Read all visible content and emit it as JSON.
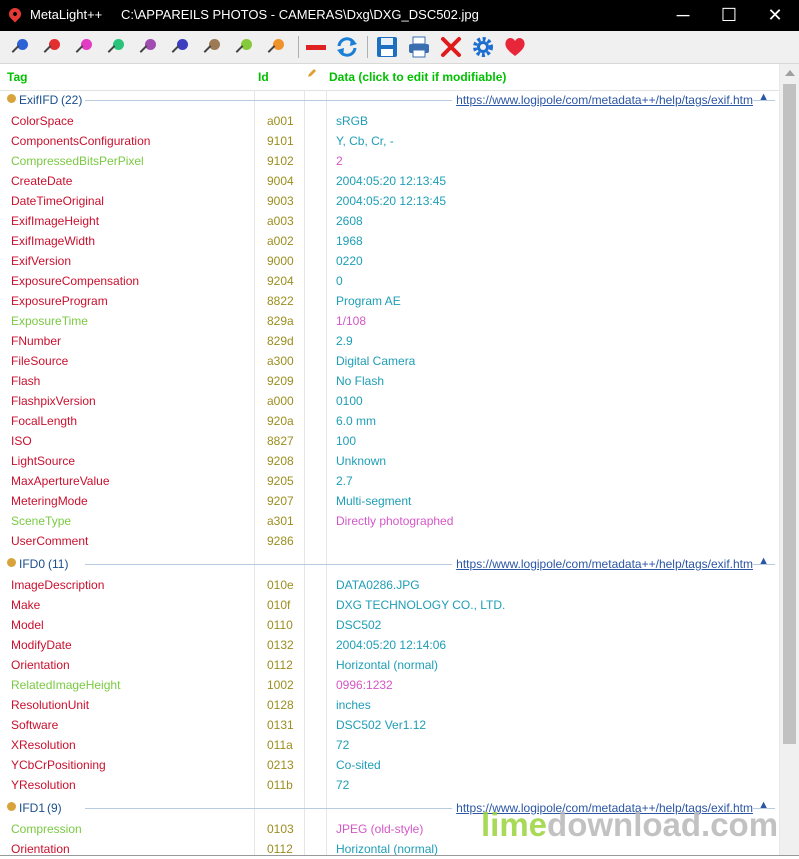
{
  "window": {
    "app_name": "MetaLight++",
    "file_path": "C:\\APPAREILS PHOTOS - CAMERAS\\Dxg\\DXG_DSC502.jpg",
    "minimize_glyph": "─",
    "maximize_glyph": "☐",
    "close_glyph": "✕"
  },
  "toolbar": {
    "pin_colors": [
      "#2c62d6",
      "#e32f2f",
      "#e23bc4",
      "#28c47a",
      "#a04cb0",
      "#3b3ec0",
      "#9b7a55",
      "#86c93a",
      "#f0922a"
    ],
    "icons": [
      "pin-icon",
      "remove-icon",
      "refresh-icon",
      "save-icon",
      "print-icon",
      "delete-icon",
      "settings-icon",
      "favorite-icon"
    ]
  },
  "columns": {
    "tag": "Tag",
    "id": "Id",
    "data": "Data (click to edit if modifiable)"
  },
  "colors": {
    "header": "#00c000",
    "tag_default": "#c8102e",
    "tag_readonly": "#7ac943",
    "id": "#9b8e1f",
    "value_default": "#1e9eb6",
    "value_readonly": "#d457c7",
    "group_name": "#1a4f8a",
    "link": "#2b56a4"
  },
  "groups": [
    {
      "name": "ExifIFD",
      "count": "(22)",
      "link": "https://www.logipole/com/metadata++/help/tags/exif.htm",
      "rows": [
        {
          "tag": "ColorSpace",
          "id": "a001",
          "value": "sRGB",
          "ro": false
        },
        {
          "tag": "ComponentsConfiguration",
          "id": "9101",
          "value": "Y, Cb, Cr, -",
          "ro": false
        },
        {
          "tag": "CompressedBitsPerPixel",
          "id": "9102",
          "value": "2",
          "ro": true
        },
        {
          "tag": "CreateDate",
          "id": "9004",
          "value": "2004:05:20 12:13:45",
          "ro": false
        },
        {
          "tag": "DateTimeOriginal",
          "id": "9003",
          "value": "2004:05:20 12:13:45",
          "ro": false
        },
        {
          "tag": "ExifImageHeight",
          "id": "a003",
          "value": "2608",
          "ro": false
        },
        {
          "tag": "ExifImageWidth",
          "id": "a002",
          "value": "1968",
          "ro": false
        },
        {
          "tag": "ExifVersion",
          "id": "9000",
          "value": "0220",
          "ro": false
        },
        {
          "tag": "ExposureCompensation",
          "id": "9204",
          "value": "0",
          "ro": false
        },
        {
          "tag": "ExposureProgram",
          "id": "8822",
          "value": "Program AE",
          "ro": false
        },
        {
          "tag": "ExposureTime",
          "id": "829a",
          "value": "1/108",
          "ro": true
        },
        {
          "tag": "FNumber",
          "id": "829d",
          "value": "2.9",
          "ro": false
        },
        {
          "tag": "FileSource",
          "id": "a300",
          "value": "Digital Camera",
          "ro": false
        },
        {
          "tag": "Flash",
          "id": "9209",
          "value": "No Flash",
          "ro": false
        },
        {
          "tag": "FlashpixVersion",
          "id": "a000",
          "value": "0100",
          "ro": false
        },
        {
          "tag": "FocalLength",
          "id": "920a",
          "value": "6.0 mm",
          "ro": false
        },
        {
          "tag": "ISO",
          "id": "8827",
          "value": "100",
          "ro": false
        },
        {
          "tag": "LightSource",
          "id": "9208",
          "value": "Unknown",
          "ro": false
        },
        {
          "tag": "MaxApertureValue",
          "id": "9205",
          "value": "2.7",
          "ro": false
        },
        {
          "tag": "MeteringMode",
          "id": "9207",
          "value": "Multi-segment",
          "ro": false
        },
        {
          "tag": "SceneType",
          "id": "a301",
          "value": "Directly photographed",
          "ro": true
        },
        {
          "tag": "UserComment",
          "id": "9286",
          "value": "",
          "ro": false
        }
      ]
    },
    {
      "name": "IFD0",
      "count": "(11)",
      "link": "https://www.logipole/com/metadata++/help/tags/exif.htm",
      "rows": [
        {
          "tag": "ImageDescription",
          "id": "010e",
          "value": "DATA0286.JPG",
          "ro": false
        },
        {
          "tag": "Make",
          "id": "010f",
          "value": "DXG TECHNOLOGY CO., LTD.",
          "ro": false
        },
        {
          "tag": "Model",
          "id": "0110",
          "value": "DSC502",
          "ro": false
        },
        {
          "tag": "ModifyDate",
          "id": "0132",
          "value": "2004:05:20 12:14:06",
          "ro": false
        },
        {
          "tag": "Orientation",
          "id": "0112",
          "value": "Horizontal (normal)",
          "ro": false
        },
        {
          "tag": "RelatedImageHeight",
          "id": "1002",
          "value": "0996:1232",
          "ro": true
        },
        {
          "tag": "ResolutionUnit",
          "id": "0128",
          "value": "inches",
          "ro": false
        },
        {
          "tag": "Software",
          "id": "0131",
          "value": "DSC502 Ver1.12",
          "ro": false
        },
        {
          "tag": "XResolution",
          "id": "011a",
          "value": "72",
          "ro": false
        },
        {
          "tag": "YCbCrPositioning",
          "id": "0213",
          "value": "Co-sited",
          "ro": false
        },
        {
          "tag": "YResolution",
          "id": "011b",
          "value": "72",
          "ro": false
        }
      ]
    },
    {
      "name": "IFD1",
      "count": "(9)",
      "link": "https://www.logipole/com/metadata++/help/tags/exif.htm",
      "rows": [
        {
          "tag": "Compression",
          "id": "0103",
          "value": "JPEG (old-style)",
          "ro": true
        },
        {
          "tag": "Orientation",
          "id": "0112",
          "value": "Horizontal (normal)",
          "ro": false
        }
      ]
    }
  ],
  "watermark": {
    "part1": "lime",
    "part2": "download.com"
  }
}
